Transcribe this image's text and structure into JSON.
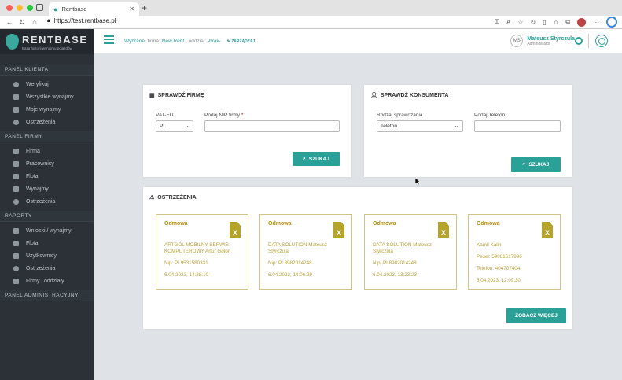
{
  "browser": {
    "tab_title": "Rentbase",
    "url": "https://test.rentbase.pl"
  },
  "brand": {
    "name": "RENTBASE",
    "tagline": "Baza historii wynajmu pojazdów",
    "accent": "#2aa096"
  },
  "sidebar": {
    "sections": [
      {
        "title": "PANEL KLIENTA",
        "items": [
          {
            "label": "Weryfikuj",
            "icon": "search-icon"
          },
          {
            "label": "Wszystkie wynajmy",
            "icon": "clipboard-icon"
          },
          {
            "label": "Moje wynajmy",
            "icon": "clipboard-icon"
          },
          {
            "label": "Ostrzeżenia",
            "icon": "bell-icon"
          }
        ]
      },
      {
        "title": "PANEL FIRMY",
        "items": [
          {
            "label": "Firma",
            "icon": "building-icon"
          },
          {
            "label": "Pracownicy",
            "icon": "users-icon"
          },
          {
            "label": "Flota",
            "icon": "car-icon"
          },
          {
            "label": "Wynajmy",
            "icon": "clipboard-icon"
          },
          {
            "label": "Ostrzeżenia",
            "icon": "bell-icon"
          }
        ]
      },
      {
        "title": "RAPORTY",
        "items": [
          {
            "label": "Wnioski / wynajmy",
            "icon": "clipboard-icon"
          },
          {
            "label": "Flota",
            "icon": "car-icon"
          },
          {
            "label": "Użytkownicy",
            "icon": "users-icon"
          },
          {
            "label": "Ostrzeżenia",
            "icon": "bell-icon"
          },
          {
            "label": "Firmy i oddziały",
            "icon": "clipboard-icon"
          }
        ]
      },
      {
        "title": "PANEL ADMINISTRACYJNY",
        "items": []
      }
    ]
  },
  "topbar": {
    "selected_label": "Wybrane:",
    "firm_label": "firma:",
    "firm_value": "New Rent",
    "branch_label": ", oddział:",
    "branch_value": "-brak-",
    "manage": "ZARZĄDZAJ",
    "user_initials": "MS",
    "user_name": "Mateusz Styrczula",
    "user_role": "Administrator"
  },
  "check_firm": {
    "title": "SPRAWDŹ FIRMĘ",
    "vat_label": "VAT-EU",
    "vat_value": "PL",
    "nip_label": "Podaj NIP firmy",
    "required_mark": "*",
    "nip_value": "",
    "search_button": "SZUKAJ"
  },
  "check_consumer": {
    "title": "SPRAWDŹ KONSUMENTA",
    "type_label": "Rodzaj sprawdzania",
    "type_value": "Telefon",
    "phone_label": "Podaj Telefon",
    "phone_value": "",
    "search_button": "SZUKAJ"
  },
  "warnings": {
    "title": "OSTRZEŻENIA",
    "more_button": "ZOBACZ WIĘCEJ",
    "cards": [
      {
        "status": "Odmowa",
        "lines": [
          "ARTGOL MOBILNY SERWIS KOMPUTEROWY Artur Golon",
          "Nip: PL9531580331",
          "6.04.2023, 14:28:10"
        ]
      },
      {
        "status": "Odmowa",
        "lines": [
          "DATA SOLUTION Mateusz Styrczula",
          "Nip: PL8982014248",
          "6.04.2023, 14:06:29"
        ]
      },
      {
        "status": "Odmowa",
        "lines": [
          "DATA SOLUTION Mateusz Styrczula",
          "Nip: PL8982014248",
          "6.04.2023, 13:23:23"
        ]
      },
      {
        "status": "Odmowa",
        "lines": [
          "Kamil Kalin",
          "Pesel: 59031617996",
          "Telefon: 404707404",
          "5.04.2023, 12:09:30"
        ]
      }
    ]
  }
}
